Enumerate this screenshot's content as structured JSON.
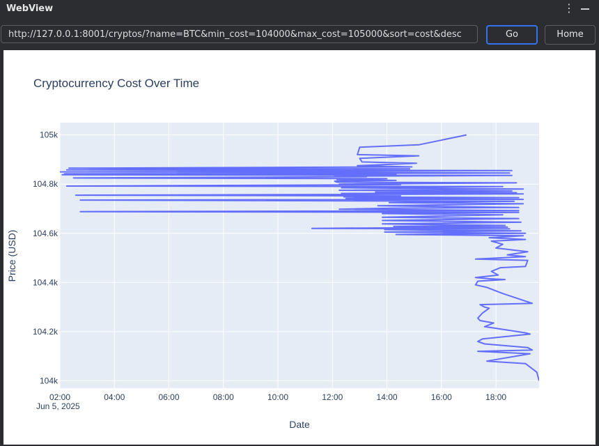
{
  "window": {
    "title": "WebView"
  },
  "toolbar": {
    "url": "http://127.0.0.1:8001/cryptos/?name=BTC&min_cost=104000&max_cost=105000&sort=cost&desc",
    "go_label": "Go",
    "home_label": "Home"
  },
  "icons": {
    "menu": "vertical-dots-icon",
    "minimize": "minimize-icon"
  },
  "colors": {
    "plot_background": "#e5ecf6",
    "line": "#636efa",
    "accent": "#3574f0"
  },
  "chart_data": {
    "type": "line",
    "title": "Cryptocurrency Cost Over Time",
    "xlabel": "Date",
    "ylabel": "Price (USD)",
    "x_axis_type": "time",
    "xlim": [
      "2025-06-05 02:00",
      "2025-06-05 19:35"
    ],
    "ylim": [
      103970,
      105050
    ],
    "x_ticks": [
      "02:00",
      "04:00",
      "06:00",
      "08:00",
      "10:00",
      "12:00",
      "14:00",
      "16:00",
      "18:00"
    ],
    "x_tick_sublabel": "Jun 5, 2025",
    "y_ticks": [
      {
        "value": 104000,
        "label": "104k"
      },
      {
        "value": 104200,
        "label": "104.2k"
      },
      {
        "value": 104400,
        "label": "104.4k"
      },
      {
        "value": 104600,
        "label": "104.6k"
      },
      {
        "value": 104800,
        "label": "104.8k"
      },
      {
        "value": 105000,
        "label": "105k"
      }
    ],
    "grid": true,
    "legend": "none",
    "series": [
      {
        "points": [
          [
            "16:55",
            105000
          ],
          [
            "15:10",
            104960
          ],
          [
            "13:00",
            104950
          ],
          [
            "12:55",
            104920
          ],
          [
            "15:10",
            104915
          ],
          [
            "13:00",
            104905
          ],
          [
            "13:05",
            104890
          ],
          [
            "15:05",
            104885
          ],
          [
            "12:55",
            104875
          ],
          [
            "14:55",
            104870
          ],
          [
            "02:20",
            104865
          ],
          [
            "14:50",
            104862
          ],
          [
            "02:15",
            104858
          ],
          [
            "18:35",
            104855
          ],
          [
            "02:00",
            104850
          ],
          [
            "12:55",
            104848
          ],
          [
            "18:30",
            104845
          ],
          [
            "02:10",
            104842
          ],
          [
            "14:20",
            104840
          ],
          [
            "02:05",
            104838
          ],
          [
            "18:35",
            104835
          ],
          [
            "12:05",
            104832
          ],
          [
            "13:15",
            104830
          ],
          [
            "02:30",
            104825
          ],
          [
            "14:00",
            104822
          ],
          [
            "12:10",
            104818
          ],
          [
            "14:20",
            104815
          ],
          [
            "12:05",
            104812
          ],
          [
            "12:10",
            104808
          ],
          [
            "18:45",
            104805
          ],
          [
            "12:15",
            104800
          ],
          [
            "14:30",
            104798
          ],
          [
            "02:15",
            104792
          ],
          [
            "18:15",
            104790
          ],
          [
            "12:20",
            104785
          ],
          [
            "19:00",
            104780
          ],
          [
            "12:15",
            104775
          ],
          [
            "18:35",
            104772
          ],
          [
            "13:35",
            104768
          ],
          [
            "18:45",
            104765
          ],
          [
            "12:20",
            104762
          ],
          [
            "19:00",
            104760
          ],
          [
            "02:35",
            104755
          ],
          [
            "14:30",
            104752
          ],
          [
            "12:25",
            104748
          ],
          [
            "18:50",
            104745
          ],
          [
            "12:30",
            104742
          ],
          [
            "19:00",
            104738
          ],
          [
            "02:45",
            104735
          ],
          [
            "18:40",
            104730
          ],
          [
            "14:05",
            104725
          ],
          [
            "19:00",
            104720
          ],
          [
            "13:40",
            104712
          ],
          [
            "18:50",
            104705
          ],
          [
            "14:10",
            104702
          ],
          [
            "12:15",
            104698
          ],
          [
            "18:50",
            104692
          ],
          [
            "02:45",
            104688
          ],
          [
            "18:50",
            104685
          ],
          [
            "13:50",
            104680
          ],
          [
            "18:15",
            104675
          ],
          [
            "13:50",
            104665
          ],
          [
            "18:50",
            104660
          ],
          [
            "13:50",
            104652
          ],
          [
            "18:55",
            104645
          ],
          [
            "13:50",
            104638
          ],
          [
            "18:20",
            104632
          ],
          [
            "14:15",
            104628
          ],
          [
            "18:25",
            104625
          ],
          [
            "11:15",
            104620
          ],
          [
            "18:30",
            104618
          ],
          [
            "13:55",
            104615
          ],
          [
            "18:55",
            104610
          ],
          [
            "13:55",
            104605
          ],
          [
            "19:05",
            104600
          ],
          [
            "14:20",
            104595
          ],
          [
            "19:00",
            104590
          ],
          [
            "17:45",
            104582
          ],
          [
            "19:05",
            104575
          ],
          [
            "17:50",
            104568
          ],
          [
            "18:15",
            104555
          ],
          [
            "18:00",
            104540
          ],
          [
            "19:10",
            104525
          ],
          [
            "18:25",
            104512
          ],
          [
            "19:05",
            104505
          ],
          [
            "17:15",
            104495
          ],
          [
            "19:10",
            104490
          ],
          [
            "19:05",
            104465
          ],
          [
            "18:10",
            104460
          ],
          [
            "17:50",
            104445
          ],
          [
            "18:05",
            104430
          ],
          [
            "17:15",
            104420
          ],
          [
            "17:45",
            104415
          ],
          [
            "18:20",
            104412
          ],
          [
            "17:20",
            104405
          ],
          [
            "17:15",
            104390
          ],
          [
            "17:40",
            104380
          ],
          [
            "18:15",
            104355
          ],
          [
            "19:20",
            104315
          ],
          [
            "17:25",
            104310
          ],
          [
            "17:35",
            104300
          ],
          [
            "17:45",
            104295
          ],
          [
            "17:30",
            104275
          ],
          [
            "17:20",
            104255
          ],
          [
            "17:25",
            104245
          ],
          [
            "17:55",
            104235
          ],
          [
            "17:35",
            104220
          ],
          [
            "17:55",
            104215
          ],
          [
            "19:05",
            104195
          ],
          [
            "19:15",
            104190
          ],
          [
            "17:30",
            104170
          ],
          [
            "17:20",
            104160
          ],
          [
            "17:35",
            104150
          ],
          [
            "19:10",
            104135
          ],
          [
            "19:20",
            104125
          ],
          [
            "17:20",
            104120
          ],
          [
            "19:15",
            104110
          ],
          [
            "17:40",
            104080
          ],
          [
            "19:05",
            104070
          ],
          [
            "19:30",
            104035
          ],
          [
            "19:35",
            104000
          ]
        ]
      }
    ]
  }
}
